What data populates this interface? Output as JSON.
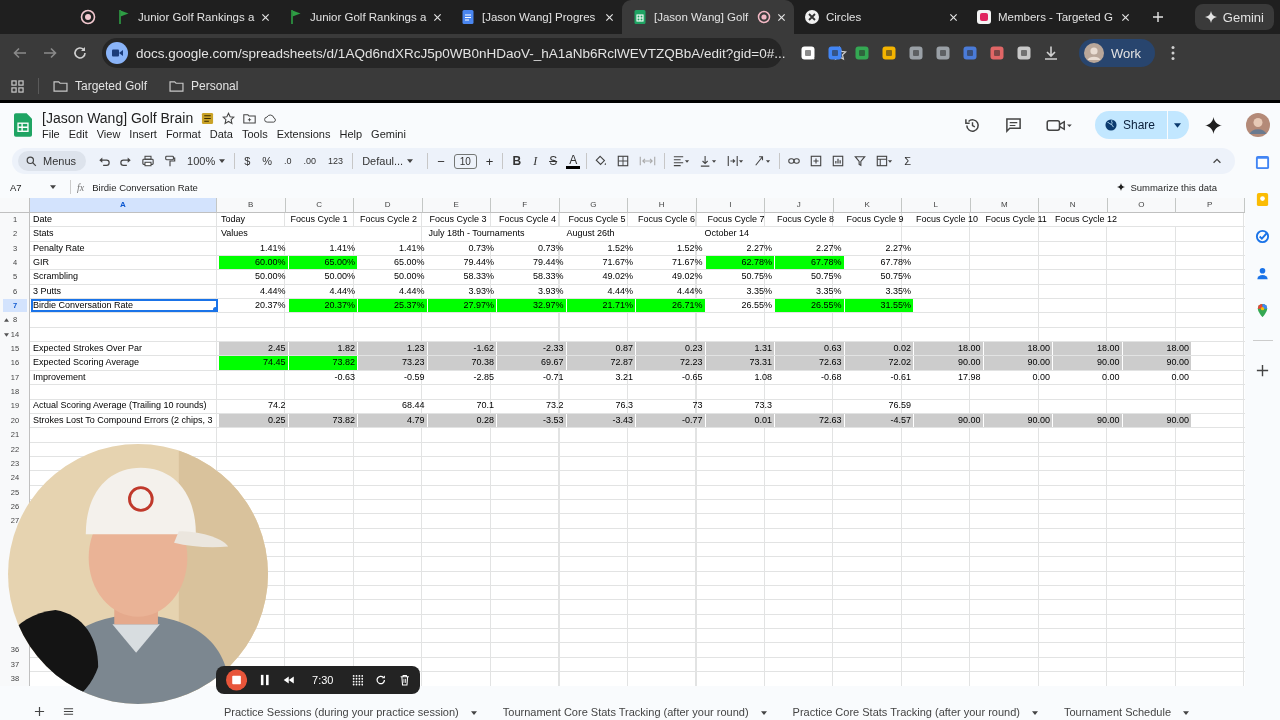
{
  "browser_tabs": [
    {
      "kind": "record",
      "selected": false,
      "recording": false
    },
    {
      "kind": "flag",
      "title": "Junior Golf Rankings a",
      "selected": false,
      "recording": false
    },
    {
      "kind": "flag",
      "title": "Junior Golf Rankings a",
      "selected": false,
      "recording": false
    },
    {
      "kind": "docs",
      "title": "[Jason Wang] Progres",
      "selected": false,
      "recording": false
    },
    {
      "kind": "sheets",
      "title": "[Jason Wang] Golf",
      "selected": true,
      "recording": true
    },
    {
      "kind": "circles",
      "title": "Circles",
      "selected": false,
      "recording": false
    },
    {
      "kind": "sk",
      "title": "Members - Targeted G",
      "selected": false,
      "recording": false
    }
  ],
  "gemini_button": "Gemini",
  "url": "docs.google.com/spreadsheets/d/1AQd6ndXRcJ5p0WB0nHDaoV-_hA1aNb6RclWEVTZQBbA/edit?gid=0#...",
  "profile": "Work",
  "bookmarks": [
    "Targeted Golf",
    "Personal"
  ],
  "doc": {
    "title": "[Jason Wang] Golf Brain",
    "menu": [
      "File",
      "Edit",
      "View",
      "Insert",
      "Format",
      "Data",
      "Tools",
      "Extensions",
      "Help",
      "Gemini"
    ],
    "share": "Share"
  },
  "toolbar": {
    "search": "Menus",
    "zoom": "100%",
    "currency": "$",
    "percent": "%",
    "decrease_decimals": ".0",
    "increase_decimals": ".00",
    "number_format": "123",
    "font": "Defaul...",
    "minus": "−",
    "font_size": "10",
    "plus": "+",
    "bold": "B",
    "italic": "I",
    "strikethrough": "S",
    "text_color": "A",
    "functions": "Σ"
  },
  "formula_bar": {
    "cell_ref": "A7",
    "fx": "fx",
    "formula": "Birdie Conversation Rate",
    "summarize": "Summarize this data"
  },
  "columns": [
    {
      "label": "A",
      "selected": true
    },
    {
      "label": "B",
      "selected": false
    },
    {
      "label": "C",
      "selected": false
    },
    {
      "label": "D",
      "selected": false
    },
    {
      "label": "E",
      "selected": false
    },
    {
      "label": "F",
      "selected": false
    },
    {
      "label": "G",
      "selected": false
    },
    {
      "label": "H",
      "selected": false
    },
    {
      "label": "I",
      "selected": false
    },
    {
      "label": "J",
      "selected": false
    },
    {
      "label": "K",
      "selected": false
    },
    {
      "label": "L",
      "selected": false
    },
    {
      "label": "M",
      "selected": false
    },
    {
      "label": "N",
      "selected": false
    },
    {
      "label": "O",
      "selected": false
    },
    {
      "label": "P",
      "selected": false
    }
  ],
  "rows": [
    {
      "num": "1",
      "kind": "header",
      "selected": false,
      "cells": [
        {
          "text": "Date"
        },
        {
          "text": "Today"
        },
        {
          "text": "Focus Cycle 1"
        },
        {
          "text": "Focus Cycle 2"
        },
        {
          "text": "Focus Cycle 3"
        },
        {
          "text": "Focus Cycle 4"
        },
        {
          "text": "Focus Cycle 5"
        },
        {
          "text": "Focus Cycle 6"
        },
        {
          "text": "Focus Cycle 7"
        },
        {
          "text": "Focus Cycle 8"
        },
        {
          "text": "Focus Cycle 9"
        },
        {
          "text": "Focus Cycle 10"
        },
        {
          "text": "Focus Cycle 11"
        },
        {
          "text": "Focus Cycle 12"
        },
        {},
        {}
      ]
    },
    {
      "num": "2",
      "kind": "header",
      "selected": false,
      "cells": [
        {
          "text": "Stats"
        },
        {
          "text": "Values"
        },
        {},
        {},
        {
          "text": "July 18th - Tournaments"
        },
        {},
        {
          "text": "August 26th"
        },
        {},
        {
          "text": "October 14"
        },
        {},
        {},
        {},
        {},
        {},
        {},
        {}
      ]
    },
    {
      "num": "3",
      "kind": "values",
      "selected": false,
      "cells": [
        {
          "text": "Penalty Rate"
        },
        {
          "text": "1.41%"
        },
        {
          "text": "1.41%"
        },
        {
          "text": "1.41%"
        },
        {
          "text": "0.73%"
        },
        {
          "text": "0.73%"
        },
        {
          "text": "1.52%"
        },
        {
          "text": "1.52%"
        },
        {
          "text": "2.27%"
        },
        {
          "text": "2.27%"
        },
        {
          "text": "2.27%"
        },
        {},
        {},
        {},
        {},
        {}
      ]
    },
    {
      "num": "4",
      "kind": "values",
      "selected": false,
      "cells": [
        {
          "text": "GIR"
        },
        {
          "text": "60.00%",
          "color": "#00ff00"
        },
        {
          "text": "65.00%",
          "color": "#00ff00"
        },
        {
          "text": "65.00%"
        },
        {
          "text": "79.44%"
        },
        {
          "text": "79.44%"
        },
        {
          "text": "71.67%"
        },
        {
          "text": "71.67%"
        },
        {
          "text": "62.78%",
          "color": "#00ff00"
        },
        {
          "text": "67.78%",
          "color": "#00ff00"
        },
        {
          "text": "67.78%"
        },
        {},
        {},
        {},
        {},
        {}
      ]
    },
    {
      "num": "5",
      "kind": "values",
      "selected": false,
      "cells": [
        {
          "text": "Scrambling"
        },
        {
          "text": "50.00%"
        },
        {
          "text": "50.00%"
        },
        {
          "text": "50.00%"
        },
        {
          "text": "58.33%"
        },
        {
          "text": "58.33%"
        },
        {
          "text": "49.02%"
        },
        {
          "text": "49.02%"
        },
        {
          "text": "50.75%"
        },
        {
          "text": "50.75%"
        },
        {
          "text": "50.75%"
        },
        {},
        {},
        {},
        {},
        {}
      ]
    },
    {
      "num": "6",
      "kind": "values",
      "selected": false,
      "cells": [
        {
          "text": "3 Putts"
        },
        {
          "text": "4.44%"
        },
        {
          "text": "4.44%"
        },
        {
          "text": "4.44%"
        },
        {
          "text": "3.93%"
        },
        {
          "text": "3.93%"
        },
        {
          "text": "4.44%"
        },
        {
          "text": "4.44%"
        },
        {
          "text": "3.35%"
        },
        {
          "text": "3.35%"
        },
        {
          "text": "3.35%"
        },
        {},
        {},
        {},
        {},
        {}
      ]
    },
    {
      "num": "7",
      "kind": "values",
      "selected": true,
      "cells": [
        {
          "text": "Birdie Conversation Rate"
        },
        {
          "text": "20.37%"
        },
        {
          "text": "20.37%",
          "color": "#00ff00"
        },
        {
          "text": "25.37%",
          "color": "#00ff00"
        },
        {
          "text": "27.97%",
          "color": "#00ff00"
        },
        {
          "text": "32.97%",
          "color": "#00ff00"
        },
        {
          "text": "21.71%",
          "color": "#00ff00"
        },
        {
          "text": "26.71%",
          "color": "#00ff00"
        },
        {
          "text": "26.55%"
        },
        {
          "text": "26.55%",
          "color": "#00ff00"
        },
        {
          "text": "31.55%",
          "color": "#00ff00"
        },
        {},
        {},
        {},
        {},
        {}
      ]
    },
    {
      "num": "8",
      "kind": "fold-top",
      "selected": false
    },
    {
      "num": "14",
      "kind": "fold-bottom",
      "selected": false
    },
    {
      "num": "15",
      "kind": "values",
      "selected": false,
      "cells": [
        {
          "text": "Expected Strokes Over Par"
        },
        {
          "text": "2.45",
          "color": "#cccccc"
        },
        {
          "text": "1.82",
          "color": "#cccccc"
        },
        {
          "text": "1.23",
          "color": "#cccccc"
        },
        {
          "text": "-1.62",
          "color": "#cccccc"
        },
        {
          "text": "-2.33",
          "color": "#cccccc"
        },
        {
          "text": "0.87",
          "color": "#cccccc"
        },
        {
          "text": "0.23",
          "color": "#cccccc"
        },
        {
          "text": "1.31",
          "color": "#cccccc"
        },
        {
          "text": "0.63",
          "color": "#cccccc"
        },
        {
          "text": "0.02",
          "color": "#cccccc"
        },
        {
          "text": "18.00",
          "color": "#cccccc"
        },
        {
          "text": "18.00",
          "color": "#cccccc"
        },
        {
          "text": "18.00",
          "color": "#cccccc"
        },
        {
          "text": "18.00",
          "color": "#cccccc"
        },
        {}
      ]
    },
    {
      "num": "16",
      "kind": "values",
      "selected": false,
      "cells": [
        {
          "text": "Expected Scoring Average"
        },
        {
          "text": "74.45",
          "color": "#00ff00"
        },
        {
          "text": "73.82",
          "color": "#00ff00"
        },
        {
          "text": "73.23",
          "color": "#cccccc"
        },
        {
          "text": "70.38",
          "color": "#cccccc"
        },
        {
          "text": "69.67",
          "color": "#cccccc"
        },
        {
          "text": "72.87",
          "color": "#cccccc"
        },
        {
          "text": "72.23",
          "color": "#cccccc"
        },
        {
          "text": "73.31",
          "color": "#cccccc"
        },
        {
          "text": "72.63",
          "color": "#cccccc"
        },
        {
          "text": "72.02",
          "color": "#cccccc"
        },
        {
          "text": "90.00",
          "color": "#cccccc"
        },
        {
          "text": "90.00",
          "color": "#cccccc"
        },
        {
          "text": "90.00",
          "color": "#cccccc"
        },
        {
          "text": "90.00",
          "color": "#cccccc"
        },
        {}
      ]
    },
    {
      "num": "17",
      "kind": "values",
      "selected": false,
      "cells": [
        {
          "text": "Improvement"
        },
        {},
        {
          "text": "-0.63"
        },
        {
          "text": "-0.59"
        },
        {
          "text": "-2.85"
        },
        {
          "text": "-0.71"
        },
        {
          "text": "3.21"
        },
        {
          "text": "-0.65"
        },
        {
          "text": "1.08"
        },
        {
          "text": "-0.68"
        },
        {
          "text": "-0.61"
        },
        {
          "text": "17.98"
        },
        {
          "text": "0.00"
        },
        {
          "text": "0.00"
        },
        {
          "text": "0.00"
        },
        {}
      ]
    },
    {
      "num": "18",
      "kind": "blank",
      "selected": false
    },
    {
      "num": "19",
      "kind": "values",
      "selected": false,
      "cells": [
        {
          "text": "Actual Scoring Average (Trailing 10 rounds)"
        },
        {
          "text": "74.2"
        },
        {},
        {
          "text": "68.44"
        },
        {
          "text": "70.1"
        },
        {
          "text": "73.2"
        },
        {
          "text": "76.3"
        },
        {
          "text": "73"
        },
        {
          "text": "73.3"
        },
        {},
        {
          "text": "76.59"
        },
        {},
        {},
        {},
        {},
        {}
      ]
    },
    {
      "num": "20",
      "kind": "values",
      "selected": false,
      "cells": [
        {
          "text": "Strokes Lost To Compound Errors (2 chips, 3"
        },
        {
          "text": "0.25",
          "color": "#cccccc"
        },
        {
          "text": "73.82",
          "color": "#cccccc"
        },
        {
          "text": "4.79",
          "color": "#cccccc"
        },
        {
          "text": "0.28",
          "color": "#cccccc"
        },
        {
          "text": "-3.53",
          "color": "#cccccc"
        },
        {
          "text": "-3.43",
          "color": "#cccccc"
        },
        {
          "text": "-0.77",
          "color": "#cccccc"
        },
        {
          "text": "0.01",
          "color": "#cccccc"
        },
        {
          "text": "72.63",
          "color": "#cccccc"
        },
        {
          "text": "-4.57",
          "color": "#cccccc"
        },
        {
          "text": "90.00",
          "color": "#cccccc"
        },
        {
          "text": "90.00",
          "color": "#cccccc"
        },
        {
          "text": "90.00",
          "color": "#cccccc"
        },
        {
          "text": "90.00",
          "color": "#cccccc"
        },
        {}
      ]
    },
    {
      "num": "21",
      "kind": "blank",
      "selected": false
    },
    {
      "num": "22",
      "kind": "blank",
      "selected": false
    },
    {
      "num": "23",
      "kind": "blank",
      "selected": false
    },
    {
      "num": "24",
      "kind": "blank",
      "selected": false
    },
    {
      "num": "25",
      "kind": "blank",
      "selected": false
    },
    {
      "num": "26",
      "kind": "blank",
      "selected": false
    },
    {
      "num": "27",
      "kind": "blank",
      "selected": false
    },
    {
      "kind": "blank"
    },
    {
      "kind": "blank"
    },
    {
      "kind": "blank"
    },
    {
      "kind": "blank"
    },
    {
      "kind": "blank"
    },
    {
      "kind": "blank"
    },
    {
      "kind": "blank"
    },
    {
      "kind": "blank"
    },
    {
      "num": "36",
      "kind": "blank",
      "selected": false
    },
    {
      "num": "37",
      "kind": "blank",
      "selected": false
    },
    {
      "num": "38",
      "kind": "blank",
      "selected": false
    }
  ],
  "sheet_tabs": [
    {
      "label": "Practice Sessions (during your practice session)",
      "selected": false
    },
    {
      "label": "Tournament Core Stats Tracking (after your round)",
      "selected": false
    },
    {
      "label": "Practice Core Stats Tracking (after your round)",
      "selected": false
    },
    {
      "label": "Tournament Schedule",
      "selected": false
    }
  ],
  "recorder": {
    "time": "7:30"
  }
}
